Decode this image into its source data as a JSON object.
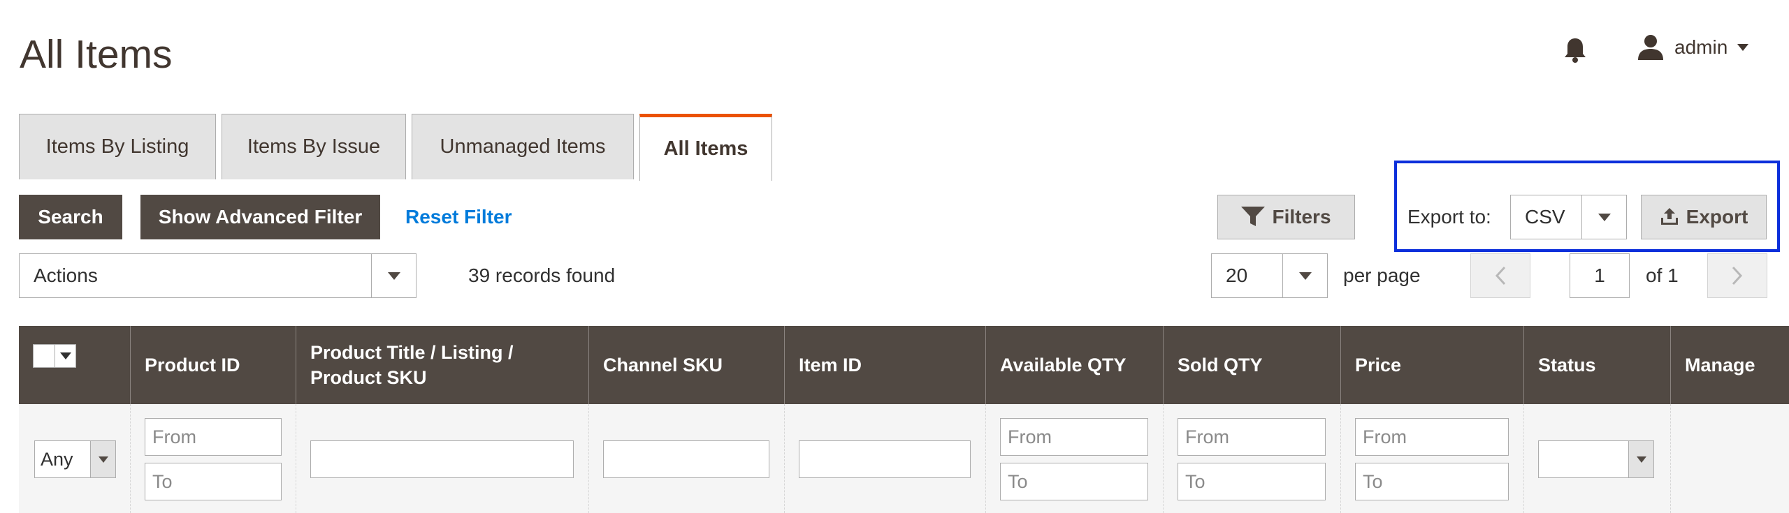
{
  "header": {
    "title": "All Items",
    "user_name": "admin"
  },
  "tabs": [
    {
      "label": "Items By Listing",
      "active": false
    },
    {
      "label": "Items By Issue",
      "active": false
    },
    {
      "label": "Unmanaged Items",
      "active": false
    },
    {
      "label": "All Items",
      "active": true
    }
  ],
  "toolbar": {
    "search_label": "Search",
    "advanced_filter_label": "Show Advanced Filter",
    "reset_filter_label": "Reset Filter",
    "filters_label": "Filters",
    "export_to_label": "Export to:",
    "export_format": "CSV",
    "export_label": "Export",
    "actions_value": "Actions",
    "records_found": "39 records found",
    "per_page_value": "20",
    "per_page_label": "per page",
    "page_number": "1",
    "of_pages": "of 1"
  },
  "grid": {
    "columns": [
      "Product ID",
      "Product Title / Listing / Product SKU",
      "Channel SKU",
      "Item ID",
      "Available QTY",
      "Sold QTY",
      "Price",
      "Status",
      "Manage"
    ],
    "filters": {
      "any_value": "Any",
      "from_placeholder": "From",
      "to_placeholder": "To"
    }
  },
  "colors": {
    "header_bg": "#514943",
    "accent": "#eb5202",
    "link": "#007bdb",
    "highlight": "#0c2fdb"
  }
}
